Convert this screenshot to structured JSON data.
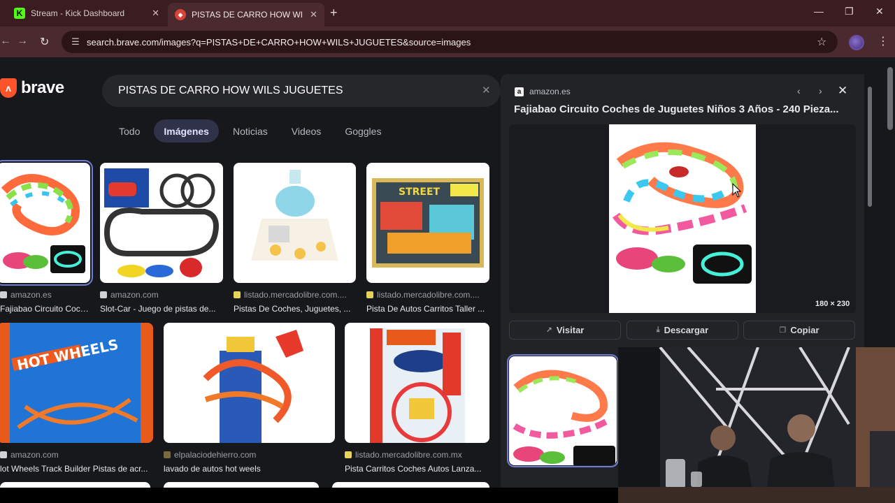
{
  "browser": {
    "tabs": [
      {
        "title": "Stream - Kick Dashboard",
        "favicon": "kick-icon",
        "active": false
      },
      {
        "title": "PISTAS DE CARRO HOW WILS J",
        "favicon": "brave-icon",
        "active": true
      }
    ],
    "url": "search.brave.com/images?q=PISTAS+DE+CARRO+HOW+WILS+JUGUETES&source=images"
  },
  "search": {
    "brand": "brave",
    "query": "PISTAS DE CARRO HOW WILS JUGUETES",
    "tabs": [
      "Todo",
      "Imágenes",
      "Noticias",
      "Videos",
      "Goggles"
    ],
    "active_tab": "Imágenes"
  },
  "results": [
    {
      "source": "amazon.es",
      "title": "Fajiabao Circuito Coch...",
      "selected": true
    },
    {
      "source": "amazon.com",
      "title": "Slot-Car - Juego de pistas de...",
      "selected": false
    },
    {
      "source": "listado.mercadolibre.com....",
      "title": "Pistas De Coches, Juguetes, ...",
      "selected": false
    },
    {
      "source": "listado.mercadolibre.com....",
      "title": "Pista De Autos Carritos Taller ...",
      "selected": false
    },
    {
      "source": "amazon.com",
      "title": "lot Wheels Track Builder Pistas de acr...",
      "selected": false
    },
    {
      "source": "elpalaciodehierro.com",
      "title": "lavado de autos hot weels",
      "selected": false
    },
    {
      "source": "listado.mercadolibre.com.mx",
      "title": "Pista Carritos Coches Autos Lanza...",
      "selected": false
    }
  ],
  "panel": {
    "domain": "amazon.es",
    "title": "Fajiabao Circuito Coches de Juguetes Niños 3 Años - 240 Pieza...",
    "dimensions": "180 × 230",
    "buttons": {
      "visit": "Visitar",
      "download": "Descargar",
      "copy": "Copiar"
    }
  },
  "colors": {
    "accent": "#6f7bd6",
    "brave": "#fb542b",
    "chrome": "#4a2a2e"
  }
}
